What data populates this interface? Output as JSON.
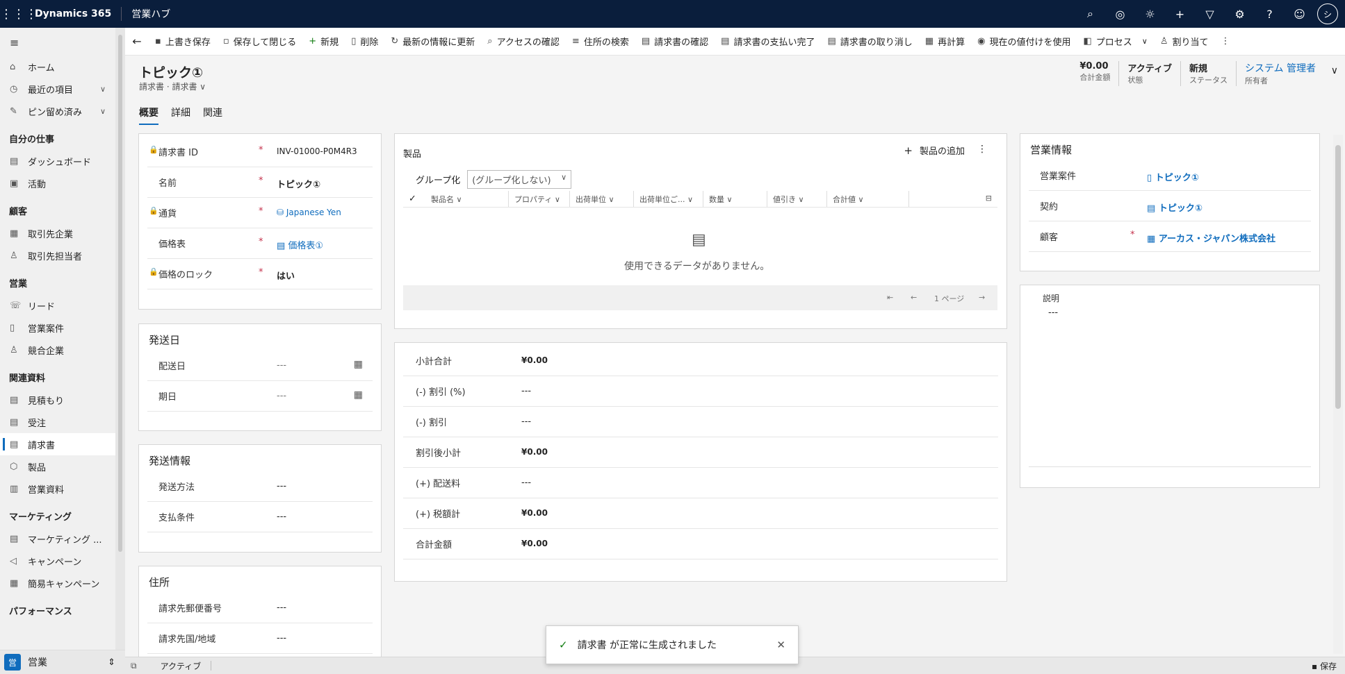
{
  "app": {
    "brand": "Dynamics 365",
    "hub": "営業ハブ",
    "avatar": "シ"
  },
  "top_icons": [
    "search-icon",
    "task-icon",
    "lightbulb-icon",
    "plus-icon",
    "filter-icon",
    "gear-icon",
    "help-icon",
    "feedback-icon"
  ],
  "sidebar": {
    "home": "ホーム",
    "recent": "最近の項目",
    "pinned": "ピン留め済み",
    "sections": [
      {
        "title": "自分の仕事",
        "items": [
          "ダッシュボード",
          "活動"
        ]
      },
      {
        "title": "顧客",
        "items": [
          "取引先企業",
          "取引先担当者"
        ]
      },
      {
        "title": "営業",
        "items": [
          "リード",
          "営業案件",
          "競合企業"
        ]
      },
      {
        "title": "関連資料",
        "items": [
          "見積もり",
          "受注",
          "請求書",
          "製品",
          "営業資料"
        ]
      },
      {
        "title": "マーケティング",
        "items": [
          "マーケティング ...",
          "キャンペーン",
          "簡易キャンペーン"
        ]
      },
      {
        "title": "パフォーマンス",
        "items": []
      }
    ],
    "area": "営業",
    "area_icon": "営"
  },
  "commands": [
    "上書き保存",
    "保存して閉じる",
    "新規",
    "削除",
    "最新の情報に更新",
    "アクセスの確認",
    "住所の検索",
    "請求書の確認",
    "請求書の支払い完了",
    "請求書の取り消し",
    "再計算",
    "現在の値付けを使用",
    "プロセス",
    "割り当て"
  ],
  "record": {
    "title": "トピック①",
    "subtitle": "請求書 · 請求書",
    "header_fields": [
      {
        "value": "¥0.00",
        "label": "合計金額"
      },
      {
        "value": "アクティブ",
        "label": "状態"
      },
      {
        "value": "新規",
        "label": "ステータス"
      },
      {
        "value": "システム 管理者",
        "label": "所有者"
      }
    ],
    "tabs": [
      "概要",
      "詳細",
      "関連"
    ]
  },
  "general": {
    "invoice_id_label": "請求書 ID",
    "invoice_id": "INV-01000-P0M4R3",
    "name_label": "名前",
    "name": "トピック①",
    "currency_label": "通貨",
    "currency": "Japanese Yen",
    "pricelist_label": "価格表",
    "pricelist": "価格表①",
    "lock_label": "価格のロック",
    "lock": "はい"
  },
  "ship_date": {
    "title": "発送日",
    "delivery_label": "配送日",
    "delivery": "---",
    "due_label": "期日",
    "due": "---"
  },
  "ship_info": {
    "title": "発送情報",
    "method_label": "発送方法",
    "method": "---",
    "terms_label": "支払条件",
    "terms": "---"
  },
  "address": {
    "title": "住所",
    "zip_label": "請求先郵便番号",
    "zip": "---",
    "country_label": "請求先国/地域",
    "country": "---"
  },
  "products": {
    "title": "製品",
    "add": "製品の追加",
    "group_label": "グループ化",
    "group_value": "(グループ化しない)",
    "columns": [
      "製品名",
      "プロパティ",
      "出荷単位",
      "出荷単位ご...",
      "数量",
      "値引き",
      "合計値"
    ],
    "empty": "使用できるデータがありません。",
    "page": "1 ページ"
  },
  "summary": [
    {
      "label": "小計合計",
      "value": "¥0.00"
    },
    {
      "label": "(-) 割引 (%)",
      "value": "---"
    },
    {
      "label": "(-) 割引",
      "value": "---"
    },
    {
      "label": "割引後小計",
      "value": "¥0.00"
    },
    {
      "label": "(+) 配送料",
      "value": "---"
    },
    {
      "label": "(+) 税額計",
      "value": "¥0.00"
    },
    {
      "label": "合計金額",
      "value": "¥0.00"
    }
  ],
  "sales_info": {
    "title": "営業情報",
    "opportunity_label": "営業案件",
    "opportunity": "トピック①",
    "contract_label": "契約",
    "contract": "トピック①",
    "customer_label": "顧客",
    "customer": "アーカス・ジャパン株式会社"
  },
  "description": {
    "label": "説明",
    "value": "---"
  },
  "toast": "請求書 が正常に生成されました",
  "status": {
    "state": "アクティブ",
    "save": "保存"
  }
}
